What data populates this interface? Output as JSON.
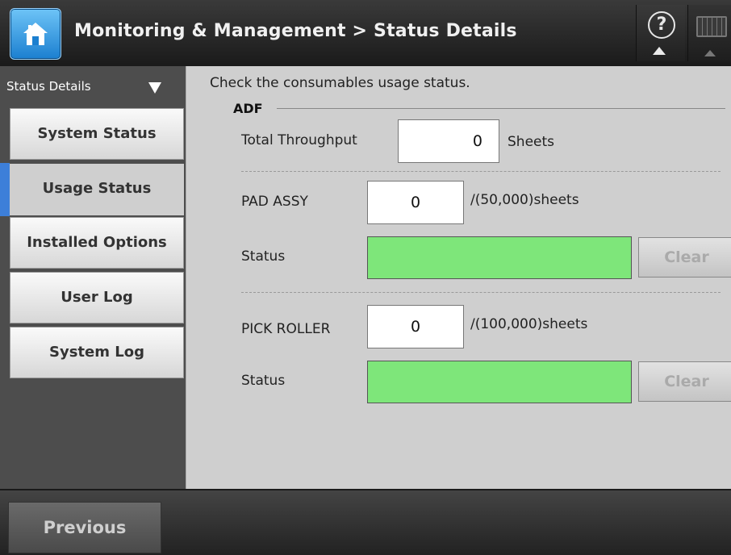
{
  "header": {
    "title": "Monitoring & Management > Status Details",
    "home_icon": "home-icon",
    "help_icon": "help-icon",
    "keyboard_icon": "keyboard-icon",
    "help_glyph": "?"
  },
  "sidebar": {
    "heading": "Status Details",
    "items": [
      {
        "label": "System Status"
      },
      {
        "label": "Usage Status",
        "active": true
      },
      {
        "label": "Installed Options"
      },
      {
        "label": "User Log"
      },
      {
        "label": "System Log"
      }
    ]
  },
  "main": {
    "intro": "Check the consumables usage status.",
    "section_title": "ADF",
    "total_throughput": {
      "label": "Total Throughput",
      "value": "0",
      "unit": "Sheets"
    },
    "pad_assy": {
      "label": "PAD ASSY",
      "value": "0",
      "limit": "/(50,000)sheets",
      "status_label": "Status",
      "clear_label": "Clear"
    },
    "pick_roller": {
      "label": "PICK ROLLER",
      "value": "0",
      "limit": "/(100,000)sheets",
      "status_label": "Status",
      "clear_label": "Clear"
    }
  },
  "footer": {
    "previous_label": "Previous"
  },
  "colors": {
    "status_ok": "#7ee67a",
    "accent": "#3d7fd9"
  }
}
